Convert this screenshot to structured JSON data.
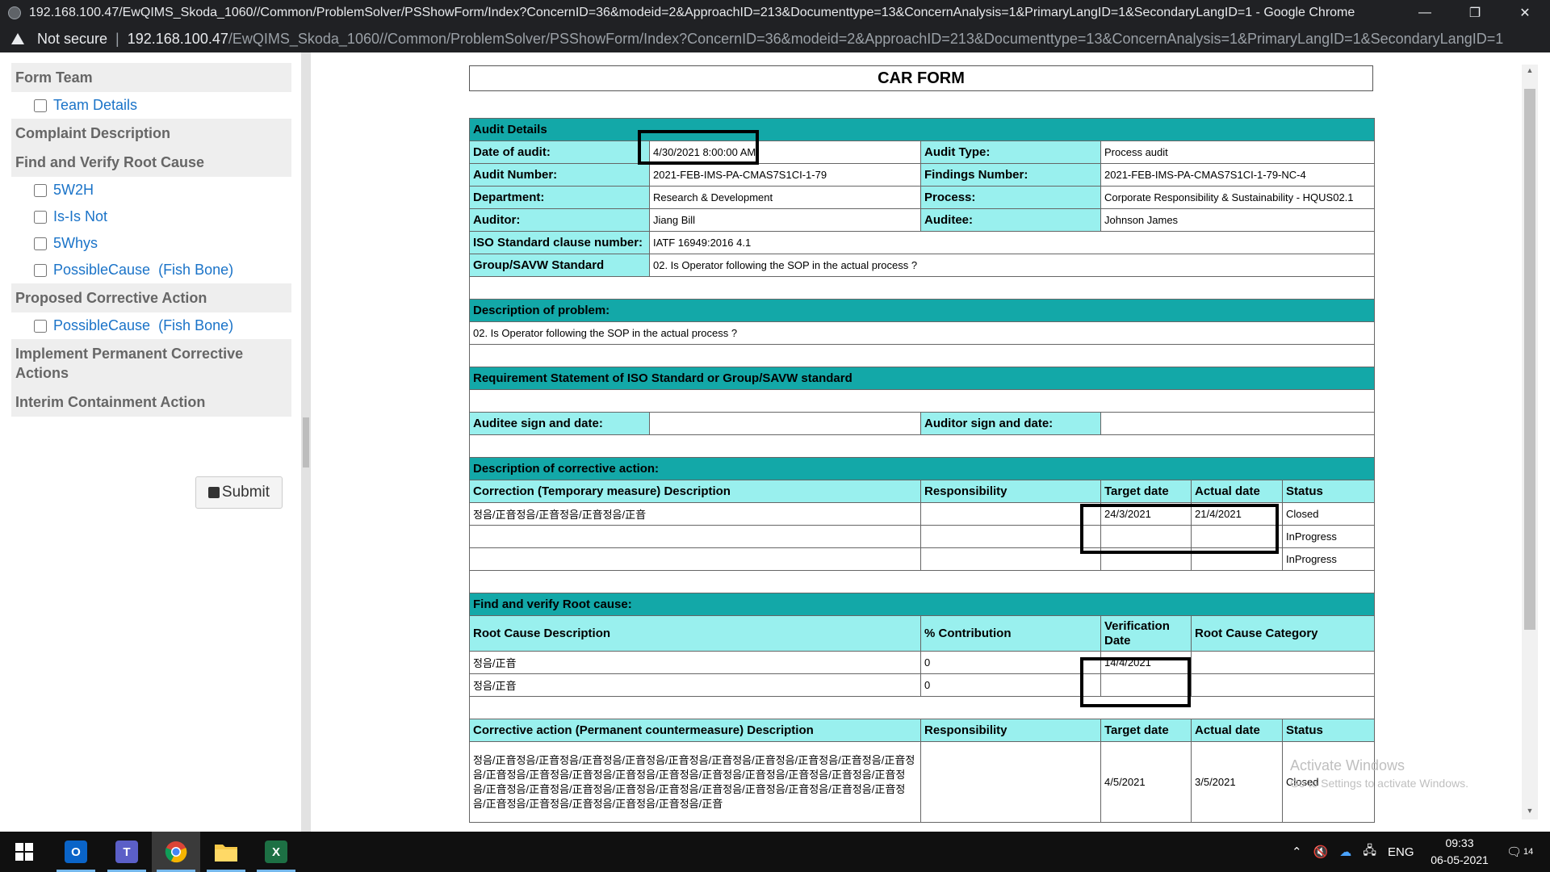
{
  "browser": {
    "window_title": "192.168.100.47/EwQIMS_Skoda_1060//Common/ProblemSolver/PSShowForm/Index?ConcernID=36&modeid=2&ApproachID=213&Documenttype=13&ConcernAnalysis=1&PrimaryLangID=1&SecondaryLangID=1 - Google Chrome",
    "not_secure": "Not secure",
    "url_host": "192.168.100.47",
    "url_path": "/EwQIMS_Skoda_1060//Common/ProblemSolver/PSShowForm/Index?ConcernID=36&modeid=2&ApproachID=213&Documenttype=13&ConcernAnalysis=1&PrimaryLangID=1&SecondaryLangID=1",
    "minimize": "—",
    "restore": "❐",
    "close": "✕"
  },
  "sidebar": {
    "form_team": "Form Team",
    "team_details": "Team Details",
    "complaint_description": "Complaint Description",
    "find_verify": "Find and Verify Root Cause",
    "w2h": "5W2H",
    "isisnot": "Is-Is Not",
    "whys": "5Whys",
    "possible_cause_1": "PossibleCause  (Fish Bone)",
    "proposed": "Proposed Corrective Action",
    "possible_cause_2": "PossibleCause  (Fish Bone)",
    "implement": "Implement Permanent Corrective Actions",
    "interim": "Interim Containment Action",
    "submit": "Submit"
  },
  "form": {
    "title": "CAR FORM",
    "audit_details": "Audit Details",
    "date_of_audit_label": "Date of audit:",
    "date_of_audit": "4/30/2021 8:00:00 AM",
    "audit_type_label": "Audit Type:",
    "audit_type": "Process audit",
    "audit_number_label": "Audit Number:",
    "audit_number": "2021-FEB-IMS-PA-CMAS7S1CI-1-79",
    "findings_number_label": "Findings Number:",
    "findings_number": "2021-FEB-IMS-PA-CMAS7S1CI-1-79-NC-4",
    "department_label": "Department:",
    "department": "Research & Development",
    "process_label": "Process:",
    "process": "Corporate Responsibility & Sustainability - HQUS02.1",
    "auditor_label": "Auditor:",
    "auditor": "Jiang Bill",
    "auditee_label": "Auditee:",
    "auditee": "Johnson James",
    "iso_label": "ISO Standard clause number:",
    "iso": "IATF 16949:2016 4.1",
    "group_label": "Group/SAVW Standard",
    "group": "02. Is Operator following the SOP in the actual process ?",
    "desc_problem_label": "Description of problem:",
    "desc_problem": "02. Is Operator following the SOP in the actual process ?",
    "req_statement_label": "Requirement Statement of ISO Standard or Group/SAVW standard",
    "auditee_sign_label": "Auditee sign and date:",
    "auditor_sign_label": "Auditor sign and date:",
    "desc_corrective_label": "Description of corrective action:",
    "corr_col_desc": "Correction (Temporary measure) Description",
    "corr_col_resp": "Responsibility",
    "corr_col_target": "Target date",
    "corr_col_actual": "Actual date",
    "corr_col_status": "Status",
    "corr_rows": [
      {
        "desc": "정음/正音정음/正音정음/正音정음/正音",
        "resp": "",
        "target": "24/3/2021",
        "actual": "21/4/2021",
        "status": "Closed"
      },
      {
        "desc": "",
        "resp": "",
        "target": "",
        "actual": "",
        "status": "InProgress"
      },
      {
        "desc": "",
        "resp": "",
        "target": "",
        "actual": "",
        "status": "InProgress"
      }
    ],
    "root_cause_label": "Find and verify Root cause:",
    "rc_col_desc": "Root Cause Description",
    "rc_col_contrib": "% Contribution",
    "rc_col_verif": "Verification Date",
    "rc_col_cat": "Root Cause Category",
    "rc_rows": [
      {
        "desc": "정음/正音",
        "contrib": "0",
        "verif": "14/4/2021",
        "cat": ""
      },
      {
        "desc": "정음/正音",
        "contrib": "0",
        "verif": "",
        "cat": ""
      }
    ],
    "perm_col_desc": "Corrective action (Permanent countermeasure) Description",
    "perm_col_resp": "Responsibility",
    "perm_col_target": "Target date",
    "perm_col_actual": "Actual date",
    "perm_col_status": "Status",
    "perm_row": {
      "desc": "정음/正音정음/正音정음/正音정음/正音정음/正音정음/正音정음/正音정음/正音정음/正音정음/正音정음/正音정음/正音정음/正音정음/正音정음/正音정음/正音정음/正音정음/正音정음/正音정음/正音정음/正音정음/正音정음/正音정음/正音정음/正音정음/正音정음/正音정음/正音정음/正音정음/正音정음/正音정음/正音정음/正音정음/正音정음/正音정음/正音",
      "resp": "",
      "target": "4/5/2021",
      "actual": "3/5/2021",
      "status": "Closed"
    }
  },
  "watermark": {
    "line1": "Activate Windows",
    "line2": "Go to Settings to activate Windows."
  },
  "taskbar": {
    "outlook": "O",
    "teams": "T",
    "excel": "X",
    "lang": "ENG",
    "time": "09:33",
    "date": "06-05-2021",
    "notif_count": "14"
  }
}
